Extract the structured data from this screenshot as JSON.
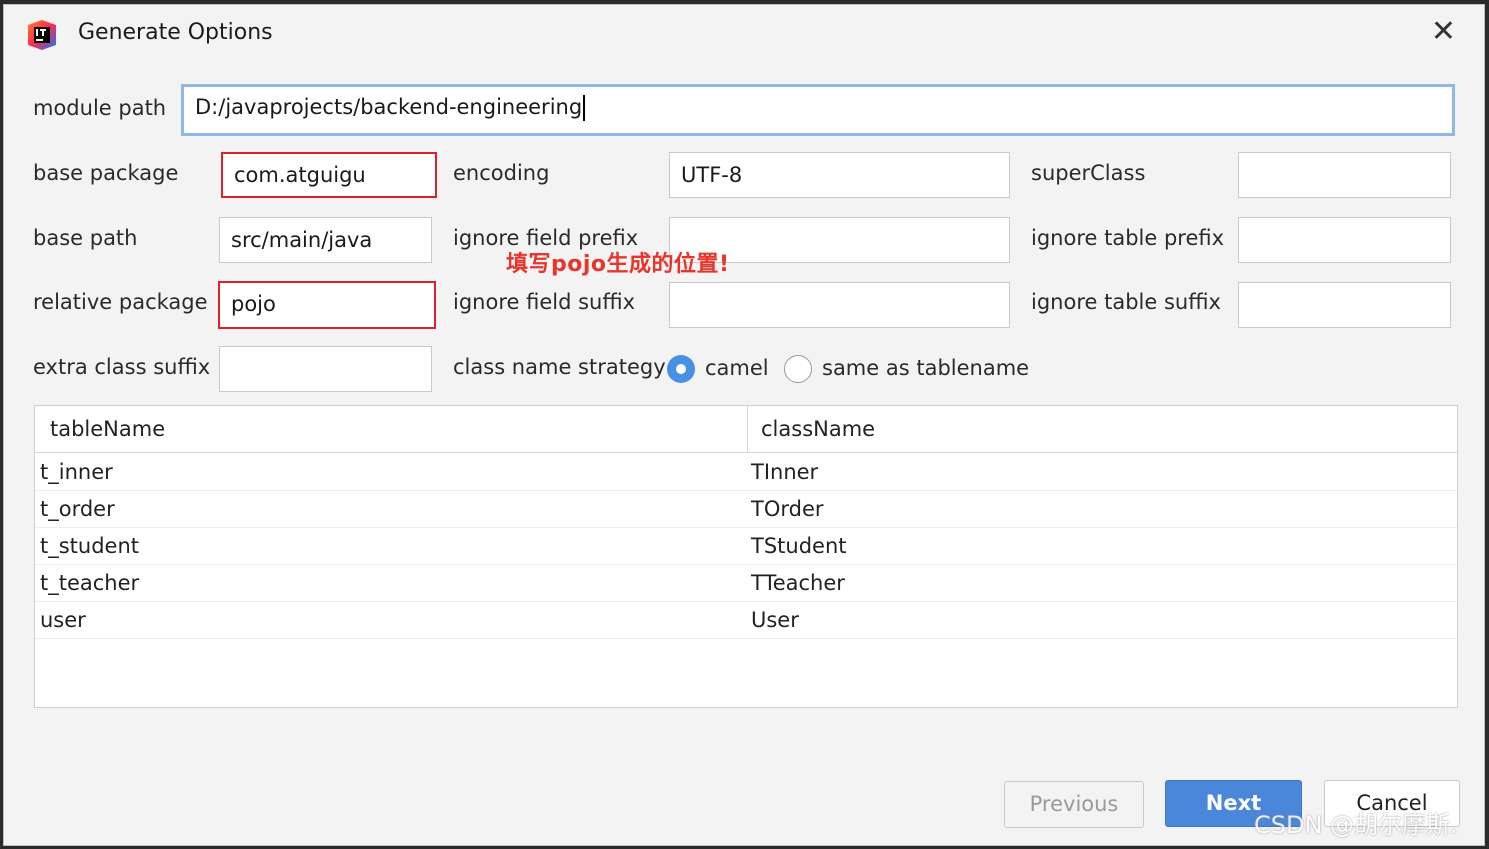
{
  "window": {
    "title": "Generate Options",
    "close_glyph": "✕"
  },
  "fields": {
    "module_path": {
      "label": "module path",
      "value": "D:/javaprojects/backend-engineering"
    },
    "base_package": {
      "label": "base package",
      "value": "com.atguigu"
    },
    "encoding": {
      "label": "encoding",
      "value": "UTF-8"
    },
    "super_class": {
      "label": "superClass",
      "value": ""
    },
    "base_path": {
      "label": "base path",
      "value": "src/main/java"
    },
    "ignore_field_prefix": {
      "label": "ignore field prefix",
      "value": ""
    },
    "ignore_table_prefix": {
      "label": "ignore table prefix",
      "value": ""
    },
    "relative_package": {
      "label": "relative package",
      "value": "pojo"
    },
    "ignore_field_suffix": {
      "label": "ignore field suffix",
      "value": ""
    },
    "ignore_table_suffix": {
      "label": "ignore table suffix",
      "value": ""
    },
    "extra_class_suffix": {
      "label": "extra class suffix",
      "value": ""
    }
  },
  "strategy": {
    "label": "class name strategy",
    "options": [
      "camel",
      "same as tablename"
    ],
    "selected": "camel"
  },
  "annotation": "填写pojo生成的位置!",
  "table": {
    "columns": [
      "tableName",
      "className"
    ],
    "rows": [
      [
        "t_inner",
        "TInner"
      ],
      [
        "t_order",
        "TOrder"
      ],
      [
        "t_student",
        "TStudent"
      ],
      [
        "t_teacher",
        "TTeacher"
      ],
      [
        "user",
        "User"
      ]
    ]
  },
  "buttons": {
    "previous": "Previous",
    "next": "Next",
    "cancel": "Cancel"
  },
  "watermark": "CSDN @胡尔摩斯.",
  "colors": {
    "accent": "#4a86d9",
    "highlight_border": "#d9232a",
    "annotation": "#e8352c"
  },
  "icons": {
    "app": "intellij-idea-icon",
    "close": "close-icon"
  }
}
